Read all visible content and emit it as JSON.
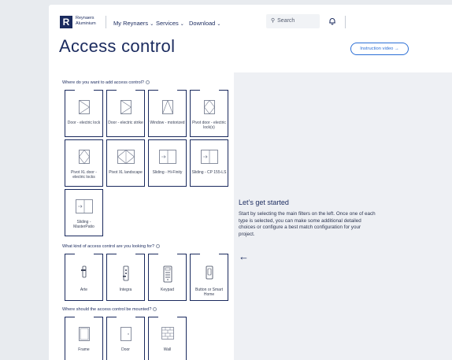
{
  "header": {
    "logo_letter": "R",
    "logo_line1": "Reynaers",
    "logo_line2": "Aluminium",
    "nav": [
      {
        "label": "My Reynaers"
      },
      {
        "label": "Services"
      },
      {
        "label": "Download"
      }
    ],
    "search_placeholder": "Search"
  },
  "page_title": "Access control",
  "instruction_video_label": "Instruction video →",
  "questions": {
    "q1": "Where do you want to add access control?",
    "q2": "What kind of access control are you looking for?",
    "q3": "Where should the access control be mounted?"
  },
  "types": [
    {
      "label": "Door - electric lock"
    },
    {
      "label": "Door - electric strike"
    },
    {
      "label": "Window - motorized"
    },
    {
      "label": "Pivot door - electric lock(s)"
    },
    {
      "label": "Pivot XL door - electric locks"
    },
    {
      "label": "Pivot XL landscape"
    },
    {
      "label": "Sliding - Hi-Finity"
    },
    {
      "label": "Sliding - CP 155-LS"
    },
    {
      "label": "Sliding - MasterPatio"
    }
  ],
  "access_kinds": [
    {
      "label": "Arte"
    },
    {
      "label": "Integra"
    },
    {
      "label": "Keypad"
    },
    {
      "label": "Button or Smart Home"
    }
  ],
  "mounts": [
    {
      "label": "Frame"
    },
    {
      "label": "Door"
    },
    {
      "label": "Wall"
    }
  ],
  "panel": {
    "title": "Let’s get started",
    "text": "Start by selecting the main filters on the left. Once one of each type is selected, you can make some additional detailed choices or configure a best match configuration for your project.",
    "arrow": "←"
  },
  "colors": {
    "brand": "#1a2a5e",
    "accent": "#2c6fd6",
    "panel_bg": "#eef0f4"
  }
}
